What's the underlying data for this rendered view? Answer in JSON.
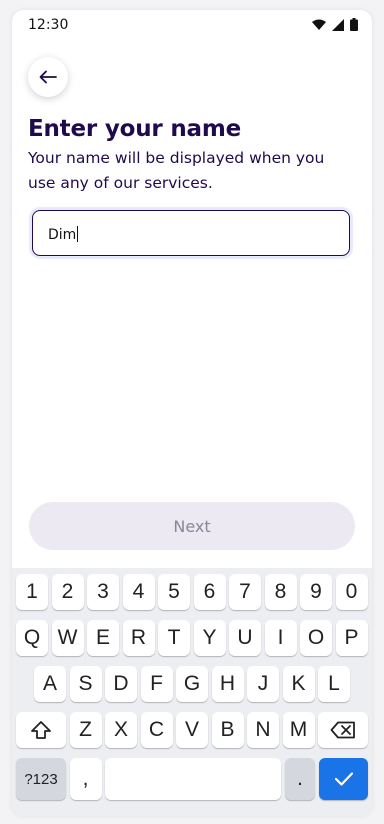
{
  "status_bar": {
    "time": "12:30"
  },
  "header": {
    "title": "Enter your name",
    "subtitle": "Your name will be displayed when you use any of our services."
  },
  "name_input": {
    "value": "Dim"
  },
  "next_button": {
    "label": "Next"
  },
  "keyboard": {
    "row1": [
      "1",
      "2",
      "3",
      "4",
      "5",
      "6",
      "7",
      "8",
      "9",
      "0"
    ],
    "row2": [
      "Q",
      "W",
      "E",
      "R",
      "T",
      "Y",
      "U",
      "I",
      "O",
      "P"
    ],
    "row3": [
      "A",
      "S",
      "D",
      "F",
      "G",
      "H",
      "J",
      "K",
      "L"
    ],
    "row4": [
      "Z",
      "X",
      "C",
      "V",
      "B",
      "N",
      "M"
    ],
    "symbols_label": "?123",
    "comma": ",",
    "period": "."
  },
  "colors": {
    "primary_text": "#1f0a4d",
    "accent": "#1b73e8",
    "disabled_button": "#ece9f2"
  },
  "icons": [
    "wifi-icon",
    "cellular-icon",
    "battery-icon",
    "back-arrow-icon",
    "shift-icon",
    "backspace-icon",
    "checkmark-icon"
  ]
}
